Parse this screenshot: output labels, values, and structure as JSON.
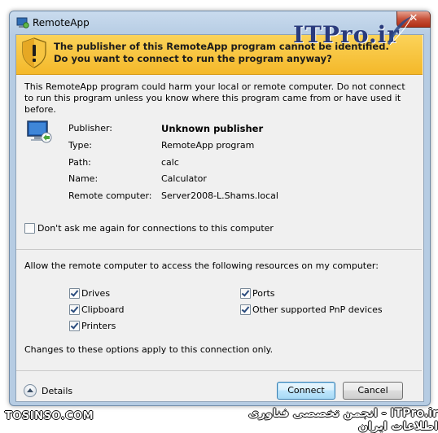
{
  "window": {
    "title": "RemoteApp",
    "close_glyph": "✕"
  },
  "banner": {
    "text": "The publisher of this RemoteApp program cannot be identified. Do you want to connect to run the program anyway?"
  },
  "warning_text": "This RemoteApp program could harm your local or remote computer. Do not connect to run this program unless you know where this program came from or have used it before.",
  "info": [
    {
      "label": "Publisher:",
      "value": "Unknown publisher"
    },
    {
      "label": "Type:",
      "value": "RemoteApp program"
    },
    {
      "label": "Path:",
      "value": "calc"
    },
    {
      "label": "Name:",
      "value": "Calculator"
    },
    {
      "label": "Remote computer:",
      "value": "Server2008-L.Shams.local"
    }
  ],
  "dont_ask": {
    "label": "Don't ask me again for connections to this computer",
    "checked": false
  },
  "resources": {
    "heading": "Allow the remote computer to access the following resources on my computer:",
    "items": [
      {
        "label": "Drives",
        "checked": true
      },
      {
        "label": "Clipboard",
        "checked": true
      },
      {
        "label": "Printers",
        "checked": true
      },
      {
        "label": "Ports",
        "checked": true
      },
      {
        "label": "Other supported PnP devices",
        "checked": true
      }
    ],
    "note": "Changes to these options apply to this connection only."
  },
  "footer": {
    "details_label": "Details",
    "connect_label": "Connect",
    "cancel_label": "Cancel"
  },
  "watermarks": {
    "top": "ITPro.ir",
    "bottom_left": "TOSINSO.COM",
    "bottom_right": "ITPro.ir - انجمن تخصصی فناوری اطلاعات ایران"
  },
  "icons": {
    "app": "remoteapp-icon",
    "shield": "warning-shield-icon",
    "monitor": "remote-computer-icon",
    "feather": "quill-icon"
  },
  "colors": {
    "banner": "#f4b82a",
    "title_bar": "#c9dbee",
    "close": "#c7523a",
    "connect_button": "#bee6fd"
  }
}
